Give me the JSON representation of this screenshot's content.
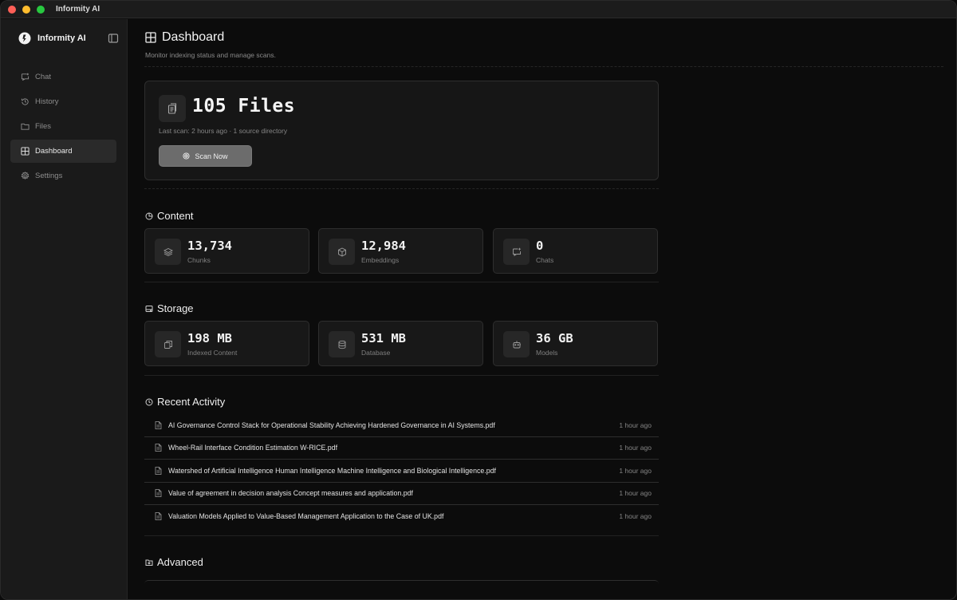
{
  "window": {
    "title": "Informity AI"
  },
  "sidebar": {
    "brand": "Informity AI",
    "items": [
      {
        "label": "Chat",
        "icon": "chat-icon"
      },
      {
        "label": "History",
        "icon": "history-icon"
      },
      {
        "label": "Files",
        "icon": "folder-icon"
      },
      {
        "label": "Dashboard",
        "icon": "grid-icon",
        "active": true
      },
      {
        "label": "Settings",
        "icon": "gear-icon"
      }
    ]
  },
  "page": {
    "title": "Dashboard",
    "subtitle": "Monitor indexing status and manage scans."
  },
  "hero": {
    "count": "105 Files",
    "meta": "Last scan: 2 hours ago · 1 source directory",
    "scan_label": "Scan Now"
  },
  "content": {
    "title": "Content",
    "cards": [
      {
        "value": "13,734",
        "label": "Chunks",
        "icon": "layers-icon"
      },
      {
        "value": "12,984",
        "label": "Embeddings",
        "icon": "cube-icon"
      },
      {
        "value": "0",
        "label": "Chats",
        "icon": "chat-plus-icon"
      }
    ]
  },
  "storage": {
    "title": "Storage",
    "cards": [
      {
        "value": "198 MB",
        "label": "Indexed Content",
        "icon": "copy-icon"
      },
      {
        "value": "531 MB",
        "label": "Database",
        "icon": "database-icon"
      },
      {
        "value": "36 GB",
        "label": "Models",
        "icon": "robot-icon"
      }
    ]
  },
  "activity": {
    "title": "Recent Activity",
    "rows": [
      {
        "name": "AI Governance Control Stack for Operational Stability Achieving Hardened Governance in AI Systems.pdf",
        "time": "1 hour ago"
      },
      {
        "name": "Wheel-Rail Interface Condition Estimation W-RICE.pdf",
        "time": "1 hour ago"
      },
      {
        "name": "Watershed of Artificial Intelligence Human Intelligence Machine Intelligence and Biological Intelligence.pdf",
        "time": "1 hour ago"
      },
      {
        "name": "Value of agreement in decision analysis Concept measures and application.pdf",
        "time": "1 hour ago"
      },
      {
        "name": "Valuation Models Applied to Value-Based Management Application to the Case of UK.pdf",
        "time": "1 hour ago"
      }
    ]
  },
  "advanced": {
    "title": "Advanced"
  },
  "colors": {
    "background": "#0c0c0c",
    "sidebar": "#1a1a1a",
    "card": "#181818",
    "accent_button": "#6c6c6c"
  }
}
